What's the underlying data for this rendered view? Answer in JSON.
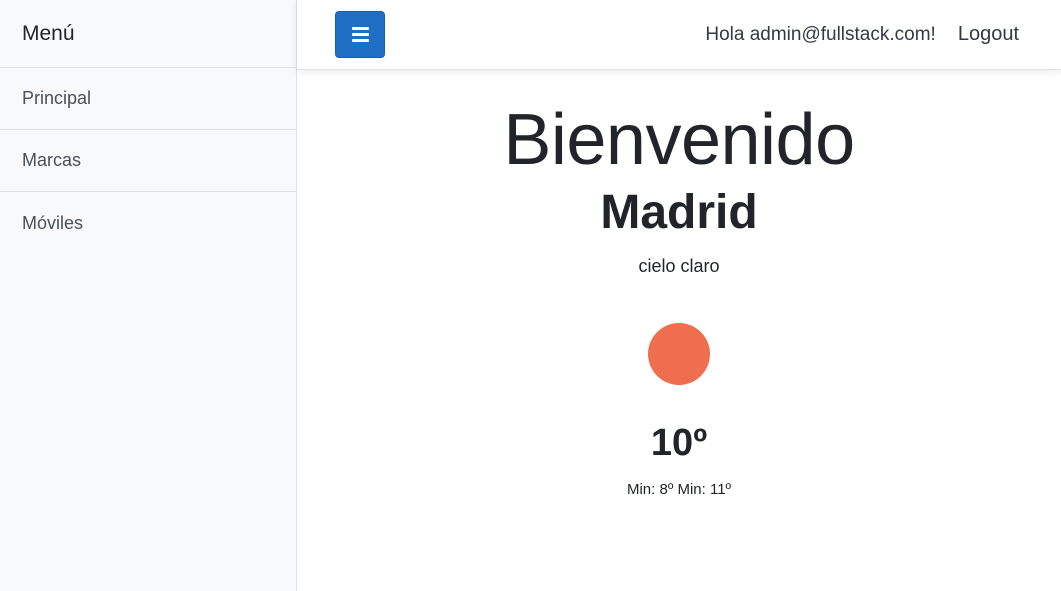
{
  "sidebar": {
    "heading": "Menú",
    "items": [
      {
        "label": "Principal"
      },
      {
        "label": "Marcas"
      },
      {
        "label": "Móviles"
      }
    ]
  },
  "topbar": {
    "toggle_icon": "hamburger-icon",
    "greeting": "Hola admin@fullstack.com!",
    "logout": "Logout",
    "accent_color": "#1f6fc5"
  },
  "weather": {
    "welcome": "Bienvenido",
    "city": "Madrid",
    "description": "cielo claro",
    "icon": "sun-icon",
    "icon_color": "#ee6e4e",
    "temperature": "10º",
    "minmax": "Min: 8º Min: 11º"
  }
}
